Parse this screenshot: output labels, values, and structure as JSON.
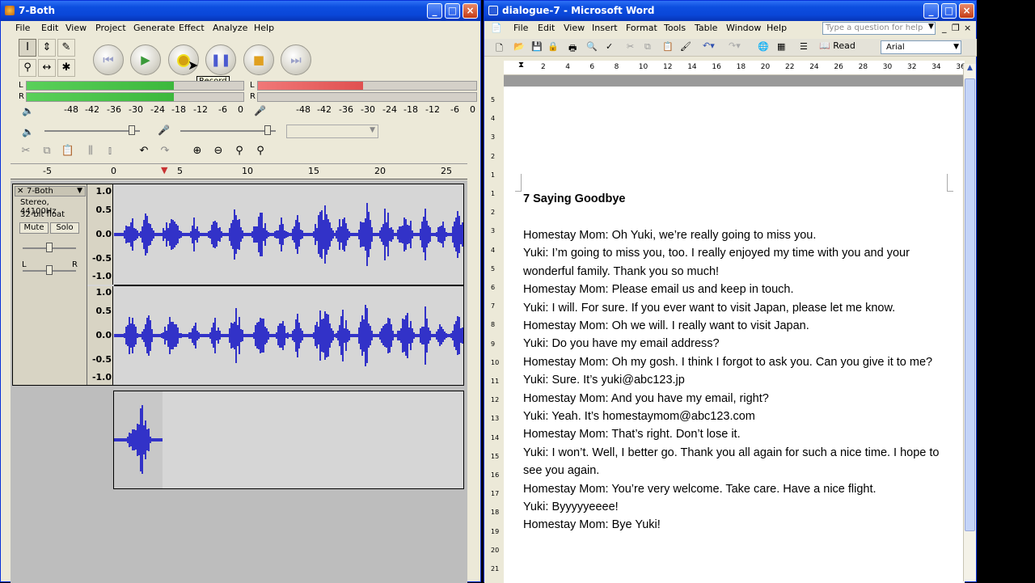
{
  "audacity": {
    "title": "7-Both",
    "menu": [
      "File",
      "Edit",
      "View",
      "Project",
      "Generate",
      "Effect",
      "Analyze",
      "Help"
    ],
    "tooltip": "Record",
    "meter_scale": [
      "-48",
      "-42",
      "-36",
      "-30",
      "-24",
      "-18",
      "-12",
      "-6",
      "0"
    ],
    "meter_labels": {
      "l": "L",
      "r": "R"
    },
    "timeline": [
      "-5",
      "0",
      "5",
      "10",
      "15",
      "20",
      "25"
    ],
    "track": {
      "name": "7-Both",
      "info1": "Stereo, 44100Hz",
      "info2": "32-bit float",
      "mute": "Mute",
      "solo": "Solo",
      "pan_l": "L",
      "pan_r": "R",
      "scale": [
        "1.0",
        "0.5",
        "0.0",
        "-0.5",
        "-1.0"
      ]
    }
  },
  "word": {
    "title": "dialogue-7 - Microsoft Word",
    "menu": [
      "File",
      "Edit",
      "View",
      "Insert",
      "Format",
      "Tools",
      "Table",
      "Window",
      "Help"
    ],
    "help_placeholder": "Type a question for help",
    "read_label": "Read",
    "font": "Arial",
    "ruler": [
      "2",
      "4",
      "6",
      "8",
      "10",
      "12",
      "14",
      "16",
      "18",
      "20",
      "22",
      "24",
      "26",
      "28",
      "30",
      "32",
      "34",
      "36"
    ],
    "vruler": [
      "5",
      "4",
      "3",
      "2",
      "1",
      "1",
      "2",
      "3",
      "4",
      "5",
      "6",
      "7",
      "8",
      "9",
      "10",
      "11",
      "12",
      "13",
      "14",
      "15",
      "16",
      "17",
      "18",
      "19",
      "20",
      "21"
    ],
    "heading": "7 Saying Goodbye",
    "lines": [
      "Homestay Mom: Oh Yuki, we’re really going to miss you.",
      "Yuki: I’m going to miss you, too. I really enjoyed my time with you and your",
      "wonderful family. Thank you so much!",
      "Homestay Mom: Please email us and keep in touch.",
      "Yuki: I will. For sure. If you ever want to visit Japan, please let me know.",
      "Homestay Mom: Oh we will. I really want to visit Japan.",
      "Yuki: Do you have my email address?",
      "Homestay Mom: Oh my gosh. I think I forgot to ask you. Can you give it to me?",
      "Yuki: Sure. It’s yuki@abc123.jp",
      "Homestay Mom: And you have my email, right?",
      "Yuki: Yeah. It’s homestaymom@abc123.com",
      "Homestay Mom: That’s right. Don’t lose it.",
      "Yuki: I won’t. Well, I better go. Thank you all again for such a nice time. I hope to",
      "see you again.",
      "Homestay Mom: You’re very welcome. Take care. Have a nice flight.",
      "Yuki: Byyyyyeeee!",
      "Homestay Mom: Bye Yuki!"
    ]
  }
}
